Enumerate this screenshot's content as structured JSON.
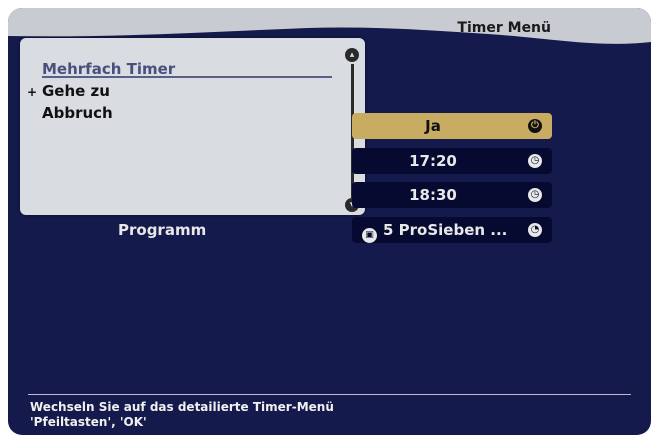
{
  "header": {
    "title": "Timer Menü"
  },
  "popup": {
    "items": [
      {
        "label": "Mehrfach Timer",
        "active": true
      },
      {
        "label": "Gehe zu",
        "active": false
      },
      {
        "label": "Abbruch",
        "active": false
      }
    ],
    "bullet": "+"
  },
  "settings": {
    "rows": [
      {
        "value": "Ja",
        "icon": "power-icon"
      },
      {
        "value": "17:20",
        "icon": "clock-icon"
      },
      {
        "value": "18:30",
        "icon": "clock-icon"
      }
    ],
    "program": {
      "label": "Programm",
      "value": "5 ProSieben ...",
      "icon": "tv-icon",
      "end_icon": "clock-icon"
    }
  },
  "status": {
    "line1": "Wechseln Sie auf das detailierte Timer-Menü",
    "line2": "'Pfeiltasten', 'OK'"
  },
  "colors": {
    "background": "#141a4c",
    "highlight": "#c8ac62",
    "popup": "#d9dce0",
    "row": "#060a30"
  }
}
